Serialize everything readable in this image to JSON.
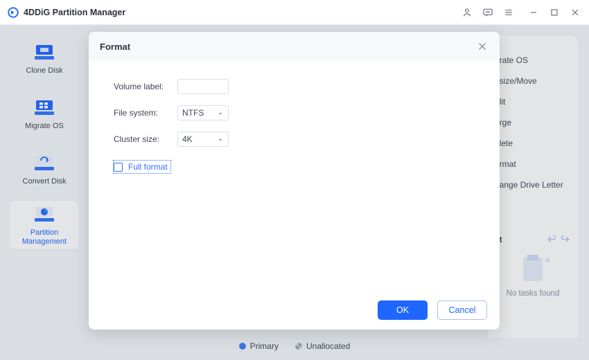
{
  "app": {
    "title": "4DDiG Partition Manager"
  },
  "sidebar": {
    "items": [
      {
        "label": "Clone Disk"
      },
      {
        "label": "Migrate OS"
      },
      {
        "label": "Convert Disk"
      },
      {
        "label": "Partition Management"
      }
    ]
  },
  "context_menu": {
    "items": [
      {
        "label": "grate OS"
      },
      {
        "label": "esize/Move"
      },
      {
        "label": "plit"
      },
      {
        "label": "erge"
      },
      {
        "label": "elete"
      },
      {
        "label": "ormat"
      },
      {
        "label": "hange Drive Letter"
      }
    ]
  },
  "tasks": {
    "heading": "st",
    "empty_text": "No tasks found"
  },
  "legend": {
    "primary": "Primary",
    "unallocated": "Unallocated"
  },
  "modal": {
    "title": "Format",
    "volume_label_label": "Volume label:",
    "volume_label_value": "",
    "file_system_label": "File system:",
    "file_system_value": "NTFS",
    "cluster_size_label": "Cluster size:",
    "cluster_size_value": "4K",
    "full_format_label": "Full format",
    "ok": "OK",
    "cancel": "Cancel"
  }
}
